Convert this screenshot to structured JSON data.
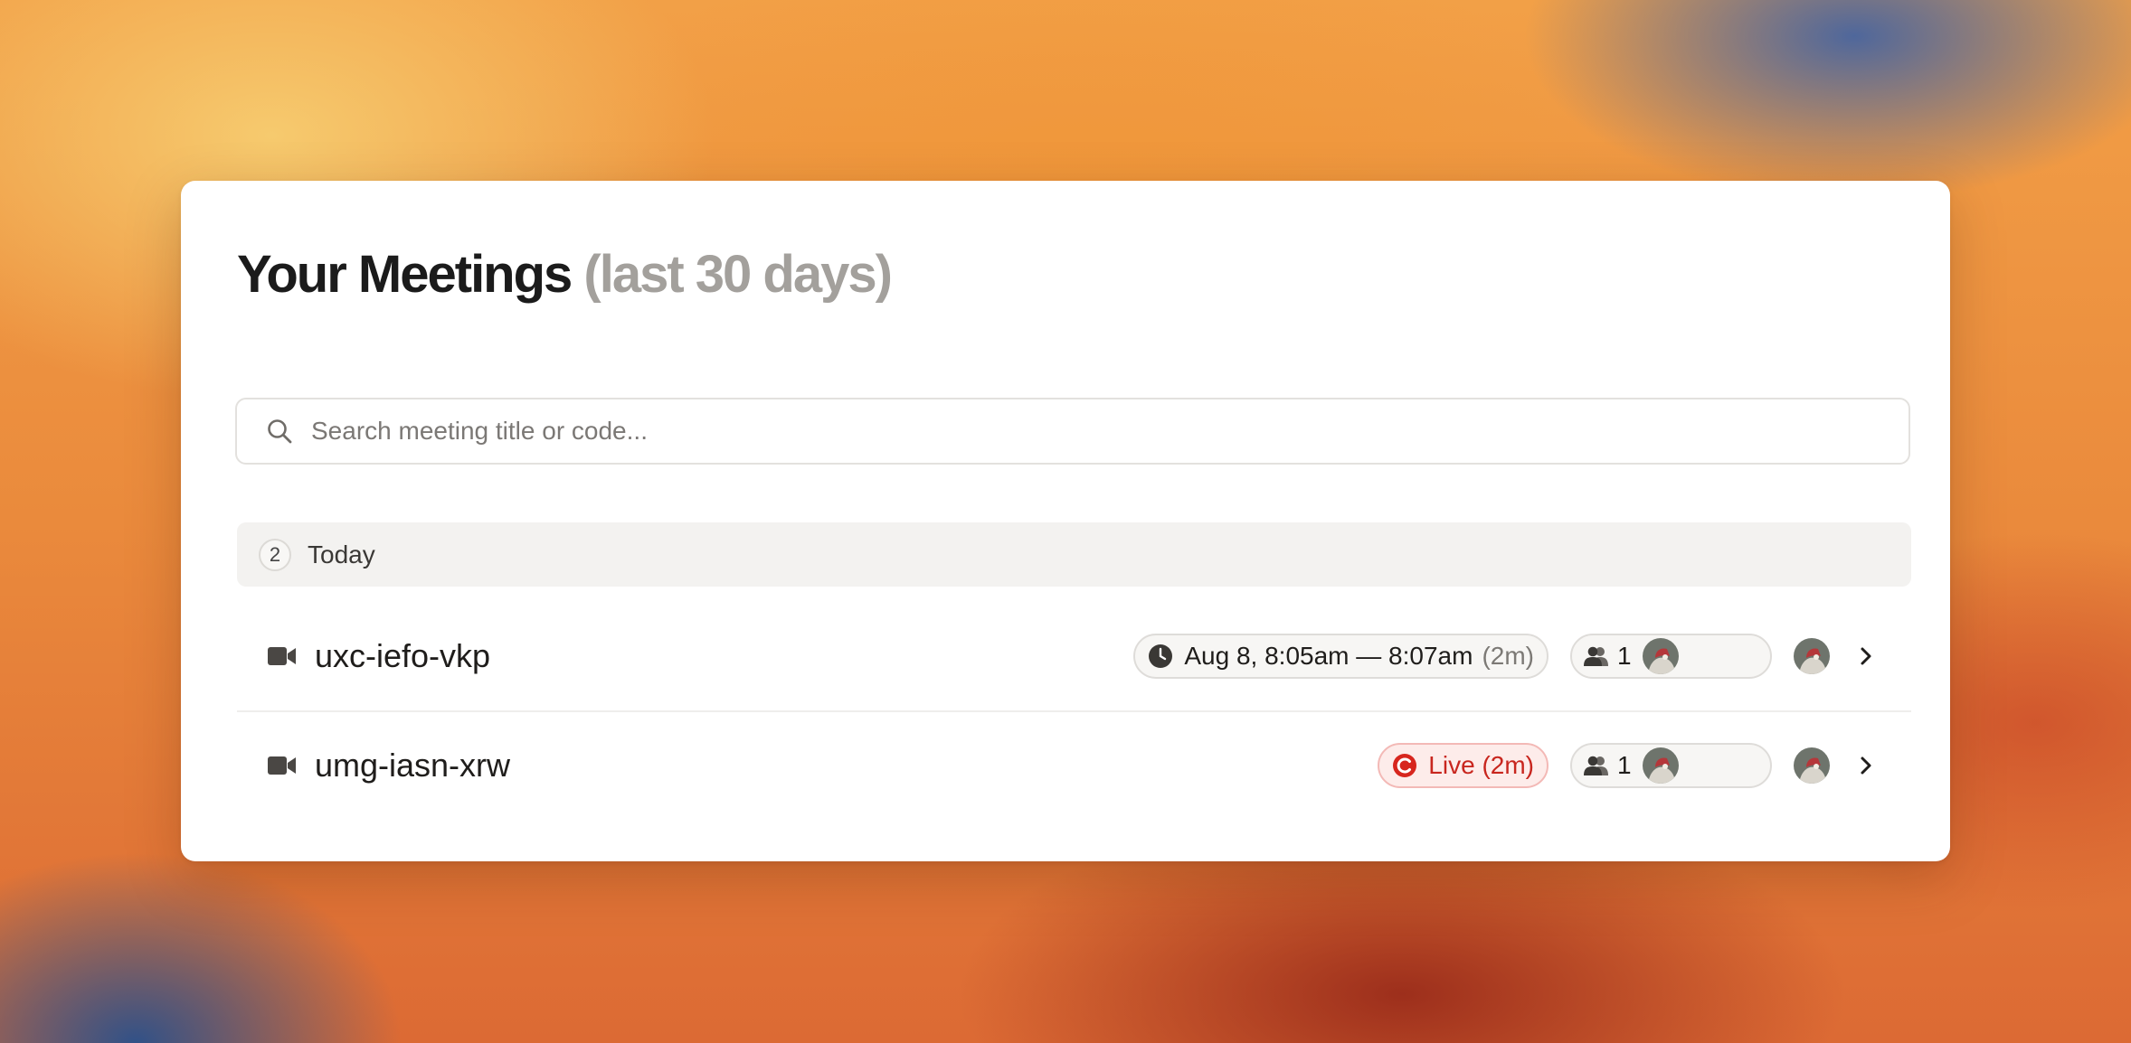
{
  "page": {
    "title": "Your Meetings",
    "title_suffix": "(last 30 days)"
  },
  "search": {
    "placeholder": "Search meeting title or code...",
    "value": ""
  },
  "groups": [
    {
      "label": "Today",
      "count": "2",
      "meetings": [
        {
          "code": "uxc-iefo-vkp",
          "status": "ended",
          "time_range": "Aug 8, 8:05am — 8:07am",
          "duration": "(2m)",
          "participant_count": "1"
        },
        {
          "code": "umg-iasn-xrw",
          "status": "live",
          "live_label": "Live (2m)",
          "participant_count": "1"
        }
      ]
    }
  ],
  "icons": {
    "search": "search-icon",
    "camera": "video-camera-icon",
    "clock": "clock-icon",
    "live": "live-record-icon",
    "people": "people-icon",
    "chevron": "chevron-right-icon"
  },
  "colors": {
    "live_text": "#c8261e",
    "live_bg": "#fdecea",
    "title_suffix": "#a3a09c"
  }
}
